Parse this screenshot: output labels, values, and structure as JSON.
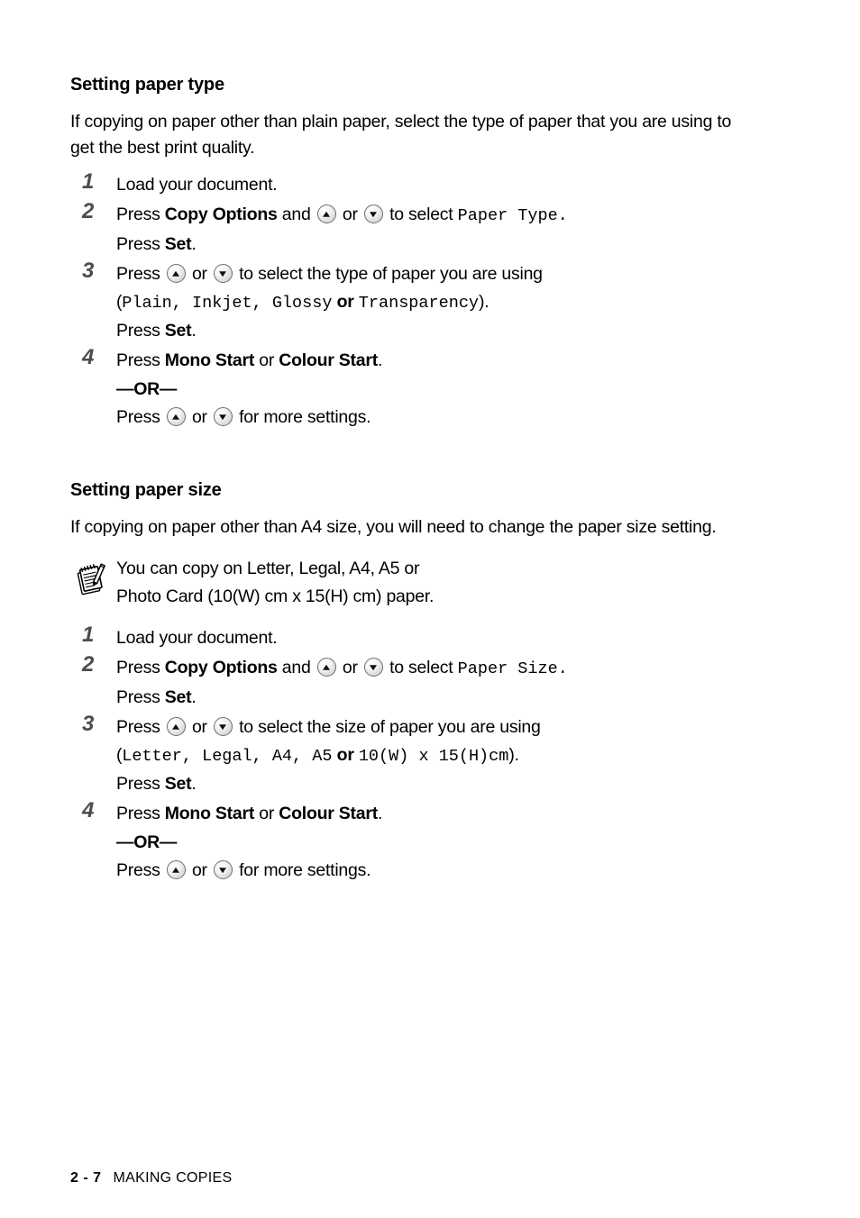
{
  "page": {
    "footer_page_number": "2 - 7",
    "footer_chapter": "MAKING COPIES"
  },
  "sections": [
    {
      "heading": "Setting paper type",
      "intro": "If copying on paper other than plain paper, select the type of paper that you are using to get the best print quality.",
      "steps": {
        "one": {
          "num": "1",
          "text": "Load your document."
        },
        "two": {
          "num": "2",
          "press": "Press",
          "copy_options": "Copy Options",
          "and": "and",
          "or": "or",
          "to_select": "to select",
          "setting": "Paper Type",
          "period": ".",
          "press_set_press": "Press",
          "press_set_key": "Set",
          "press_set_period": "."
        },
        "three": {
          "num": "3",
          "press": "Press",
          "or": "or",
          "tail": "to select the type of paper you are using",
          "open_paren": "(",
          "opt1": "Plain",
          "comma1": ", ",
          "opt2": "Inkjet",
          "comma2": ", ",
          "opt3": "Glossy",
          "or_word": "or",
          "opt4": "Transparency",
          "close_paren": ").",
          "press_set_press": "Press",
          "press_set_key": "Set",
          "press_set_period": "."
        },
        "four": {
          "num": "4",
          "press": "Press",
          "mono_start": "Mono Start",
          "or": "or",
          "colour_start": "Colour Start",
          "period": ".",
          "or_divider": "—OR—",
          "press2": "Press",
          "or2": "or",
          "tail2": "for more settings."
        }
      }
    },
    {
      "heading": "Setting paper size",
      "intro": "If copying on paper other than A4 size, you will need to change the paper size setting.",
      "note": {
        "line1": "You can copy on Letter, Legal, A4, A5 or",
        "line2": "Photo Card (10(W) cm x 15(H) cm) paper."
      },
      "steps": {
        "one": {
          "num": "1",
          "text": "Load your document."
        },
        "two": {
          "num": "2",
          "press": "Press",
          "copy_options": "Copy Options",
          "and": "and",
          "or": "or",
          "to_select": "to select",
          "setting": "Paper Size",
          "period": ".",
          "press_set_press": "Press",
          "press_set_key": "Set",
          "press_set_period": "."
        },
        "three": {
          "num": "3",
          "press": "Press",
          "or": "or",
          "tail": "to select the size of paper you are using",
          "open_paren": "(",
          "opt1": "Letter",
          "comma1": ", ",
          "opt2": "Legal",
          "comma2": ", ",
          "opt3": "A4",
          "comma3": ", ",
          "opt4": "A5",
          "or_word": "or",
          "opt5": "10(W) x 15(H)cm",
          "close_paren": ").",
          "press_set_press": "Press",
          "press_set_key": "Set",
          "press_set_period": "."
        },
        "four": {
          "num": "4",
          "press": "Press",
          "mono_start": "Mono Start",
          "or": "or",
          "colour_start": "Colour Start",
          "period": ".",
          "or_divider": "—OR—",
          "press2": "Press",
          "or2": "or",
          "tail2": "for more settings."
        }
      }
    }
  ],
  "icons": {
    "up_arrow": "arrow-up-key-icon",
    "down_arrow": "arrow-down-key-icon",
    "note": "notepad-pencil-icon"
  }
}
